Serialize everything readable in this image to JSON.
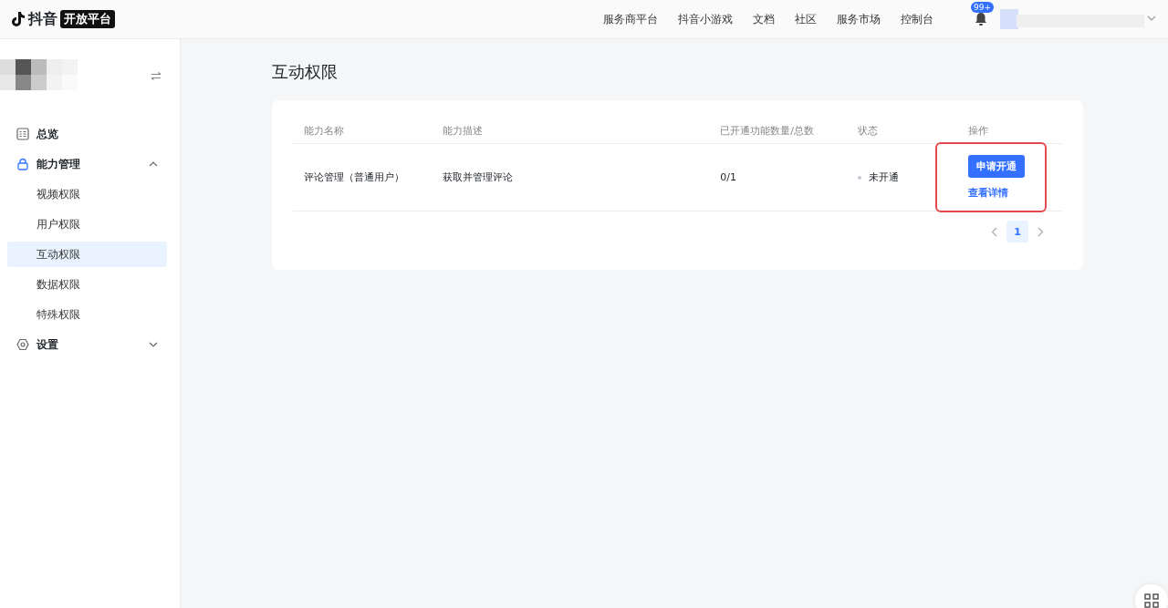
{
  "header": {
    "logo_text": "抖音",
    "logo_badge": "开放平台",
    "nav": [
      "服务商平台",
      "抖音小游戏",
      "文档",
      "社区",
      "服务市场",
      "控制台"
    ],
    "notification_badge": "99+"
  },
  "sidebar": {
    "items": [
      {
        "label": "总览",
        "kind": "overview",
        "selected": false
      },
      {
        "label": "能力管理",
        "kind": "lock",
        "expanded": true,
        "selected": false,
        "children": [
          {
            "label": "视频权限",
            "selected": false
          },
          {
            "label": "用户权限",
            "selected": false
          },
          {
            "label": "互动权限",
            "selected": true
          },
          {
            "label": "数据权限",
            "selected": false
          },
          {
            "label": "特殊权限",
            "selected": false
          }
        ]
      },
      {
        "label": "设置",
        "kind": "settings",
        "expanded": false,
        "selected": false
      }
    ]
  },
  "page": {
    "title": "互动权限"
  },
  "table": {
    "columns": [
      "能力名称",
      "能力描述",
      "已开通功能数量/总数",
      "状态",
      "操作"
    ],
    "rows": [
      {
        "name": "评论管理（普通用户）",
        "description": "获取并管理评论",
        "count": "0/1",
        "status": "未开通",
        "actions": [
          {
            "kind": "primary",
            "label": "申请开通"
          },
          {
            "kind": "link",
            "label": "查看详情"
          }
        ]
      }
    ]
  },
  "pagination": {
    "pages": [
      {
        "label": "1",
        "selected": true
      }
    ]
  }
}
